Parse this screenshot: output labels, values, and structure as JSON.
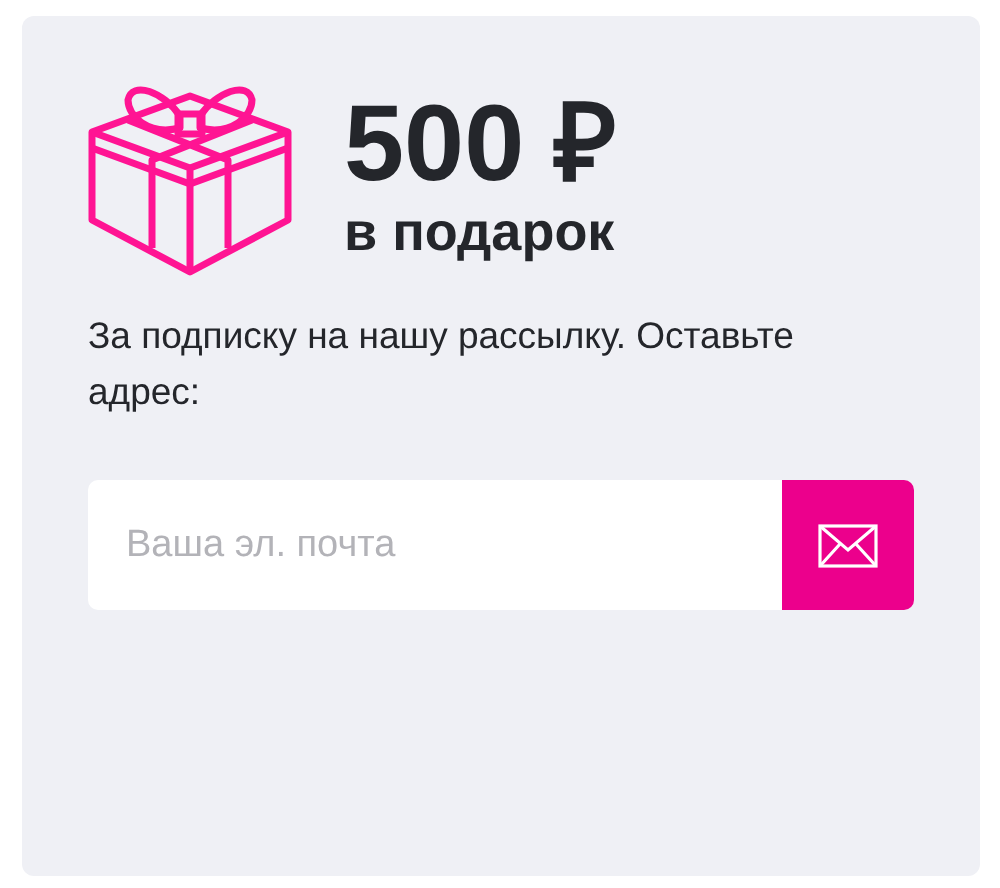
{
  "promo": {
    "amount": "500 ₽",
    "subtitle": "в подарок"
  },
  "description": "За подписку на нашу рассылку. Оставьте адрес:",
  "email_field": {
    "placeholder": "Ваша эл. почта"
  }
}
